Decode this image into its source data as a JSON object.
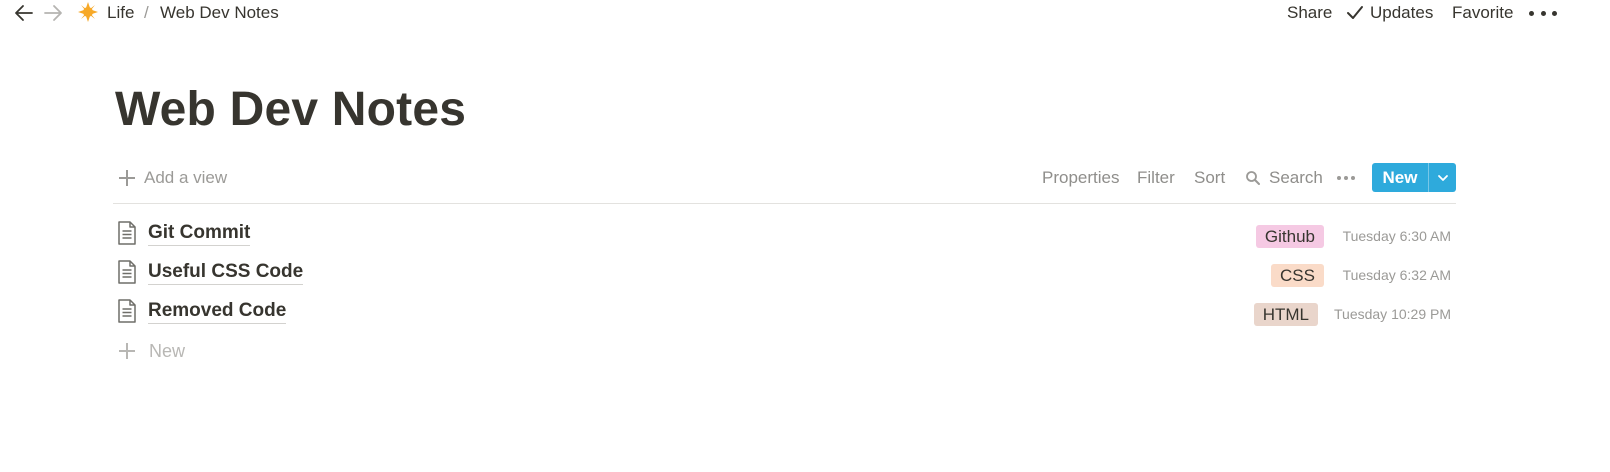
{
  "breadcrumb": {
    "parent": "Life",
    "separator": "/",
    "current": "Web Dev Notes"
  },
  "topbar": {
    "share": "Share",
    "updates": "Updates",
    "favorite": "Favorite"
  },
  "page": {
    "title": "Web Dev Notes"
  },
  "viewbar": {
    "add_view": "Add a view",
    "properties": "Properties",
    "filter": "Filter",
    "sort": "Sort",
    "search": "Search",
    "new_button": "New"
  },
  "rows": [
    {
      "title": "Git Commit",
      "tag": "Github",
      "tag_color": "#f5c9e3",
      "time": "Tuesday 6:30 AM"
    },
    {
      "title": "Useful CSS Code",
      "tag": "CSS",
      "tag_color": "#fadbc8",
      "time": "Tuesday 6:32 AM"
    },
    {
      "title": "Removed Code",
      "tag": "HTML",
      "tag_color": "#e9d5cb",
      "time": "Tuesday 10:29 PM"
    }
  ],
  "new_row": "New",
  "colors": {
    "accent": "#2eaadc",
    "text": "#37352f",
    "muted": "#9b9a97"
  },
  "icons": {
    "back": "arrow-left-icon",
    "forward": "arrow-right-icon",
    "page_icon": "star-icon",
    "check": "check-icon",
    "more": "more-horizontal-icon",
    "plus": "plus-icon",
    "search": "search-icon",
    "chevron": "chevron-down-icon",
    "doc": "document-icon"
  }
}
